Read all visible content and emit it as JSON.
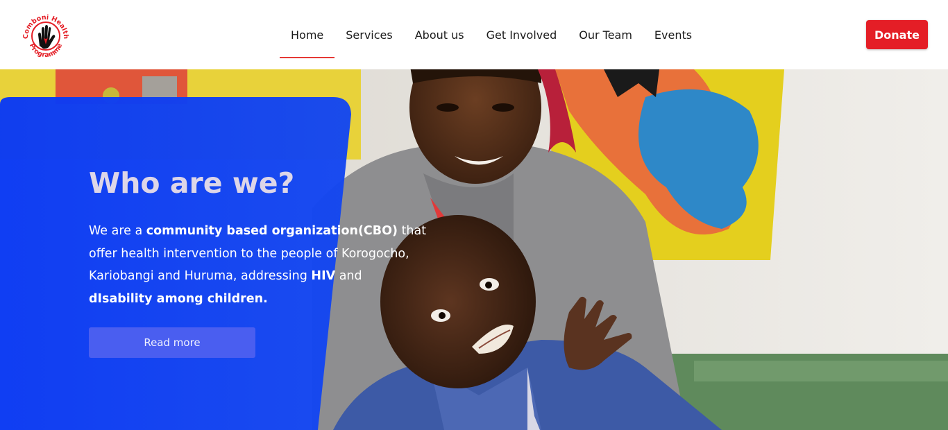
{
  "header": {
    "logo": {
      "text_top": "Comboni Health",
      "text_bottom": "Programme",
      "icon": "hand-icon"
    },
    "nav": [
      {
        "label": "Home",
        "active": true
      },
      {
        "label": "Services",
        "active": false
      },
      {
        "label": "About us",
        "active": false
      },
      {
        "label": "Get Involved",
        "active": false
      },
      {
        "label": "Our Team",
        "active": false
      },
      {
        "label": "Events",
        "active": false
      }
    ],
    "donate_label": "Donate"
  },
  "hero": {
    "title": "Who are we?",
    "body": {
      "p1": "We are a ",
      "b1": "community based organization(CBO)",
      "p2": " that offer health intervention to the people of Korogocho, Kariobangi and Huruma, addressing ",
      "b2": "HIV",
      "p3": " and ",
      "b3": "dIsability among children."
    },
    "button_label": "Read more"
  },
  "colors": {
    "accent": "#e41e26",
    "hero_panel": "#0b3df2",
    "button": "#4a5ef0"
  }
}
